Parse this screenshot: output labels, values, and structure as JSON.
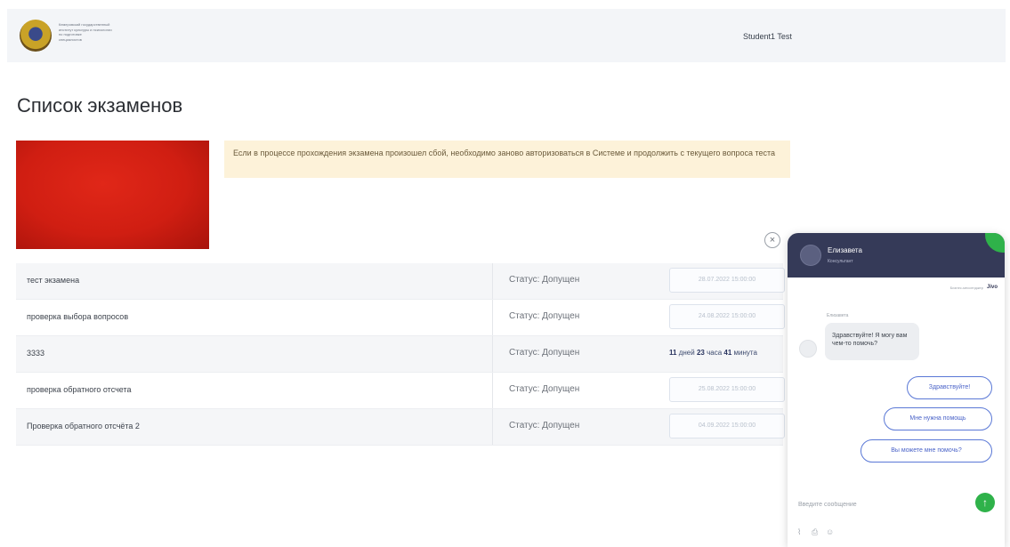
{
  "header": {
    "org_name": "Кемеровский государственный\nинститут культуры и психологии\nпо подготовке\nспециалистов",
    "user_name": "Student1 Test"
  },
  "page_title": "Список экзаменов",
  "notice": "Если в процессе прохождения экзамена произошел сбой, необходимо заново авторизоваться в Системе и продолжить с текущего вопроса теста",
  "exams": [
    {
      "name": "тест экзамена",
      "status": "Статус: Допущен",
      "date": "28.07.2022 15:00:00"
    },
    {
      "name": "проверка выбора вопросов",
      "status": "Статус: Допущен",
      "date": "24.08.2022 15:00:00"
    },
    {
      "name": "3333",
      "status": "Статус: Допущен",
      "countdown": {
        "days": "11",
        "days_label": "дней",
        "hours": "23",
        "hours_label": "часа",
        "minutes": "41",
        "minutes_label": "минута"
      }
    },
    {
      "name": "проверка обратного отсчета",
      "status": "Статус: Допущен",
      "date": "25.08.2022 15:00:00"
    },
    {
      "name": "Проверка обратного отсчёта 2",
      "status": "Статус: Допущен",
      "date": "04.09.2022 15:00:00"
    }
  ],
  "chat": {
    "agent_name": "Елизавета",
    "agent_role": "Консультант",
    "powered_by": "Бизнес-мессенджер",
    "powered_logo": "Jivo",
    "sender": "Елизавета",
    "message": "Здравствуйте! Я могу вам чем-то помочь?",
    "quick_replies": [
      "Здравствуйте!",
      "Мне нужна помощь",
      "Вы можете мне помочь?"
    ],
    "input_placeholder": "Введите сообщение",
    "accent_color": "#2fb24a",
    "header_color": "#353a58"
  }
}
